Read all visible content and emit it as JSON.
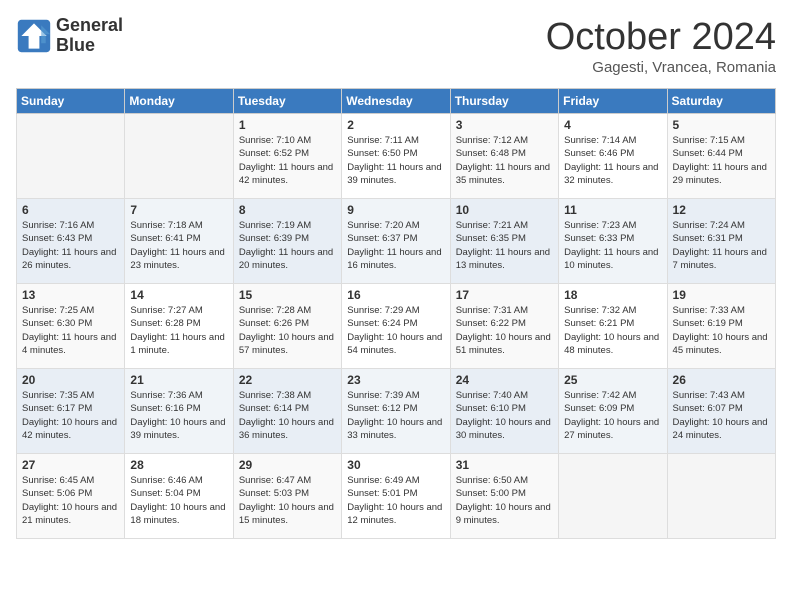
{
  "logo": {
    "line1": "General",
    "line2": "Blue"
  },
  "title": "October 2024",
  "location": "Gagesti, Vrancea, Romania",
  "days_of_week": [
    "Sunday",
    "Monday",
    "Tuesday",
    "Wednesday",
    "Thursday",
    "Friday",
    "Saturday"
  ],
  "weeks": [
    [
      {
        "day": "",
        "sunrise": "",
        "sunset": "",
        "daylight": ""
      },
      {
        "day": "",
        "sunrise": "",
        "sunset": "",
        "daylight": ""
      },
      {
        "day": "1",
        "sunrise": "Sunrise: 7:10 AM",
        "sunset": "Sunset: 6:52 PM",
        "daylight": "Daylight: 11 hours and 42 minutes."
      },
      {
        "day": "2",
        "sunrise": "Sunrise: 7:11 AM",
        "sunset": "Sunset: 6:50 PM",
        "daylight": "Daylight: 11 hours and 39 minutes."
      },
      {
        "day": "3",
        "sunrise": "Sunrise: 7:12 AM",
        "sunset": "Sunset: 6:48 PM",
        "daylight": "Daylight: 11 hours and 35 minutes."
      },
      {
        "day": "4",
        "sunrise": "Sunrise: 7:14 AM",
        "sunset": "Sunset: 6:46 PM",
        "daylight": "Daylight: 11 hours and 32 minutes."
      },
      {
        "day": "5",
        "sunrise": "Sunrise: 7:15 AM",
        "sunset": "Sunset: 6:44 PM",
        "daylight": "Daylight: 11 hours and 29 minutes."
      }
    ],
    [
      {
        "day": "6",
        "sunrise": "Sunrise: 7:16 AM",
        "sunset": "Sunset: 6:43 PM",
        "daylight": "Daylight: 11 hours and 26 minutes."
      },
      {
        "day": "7",
        "sunrise": "Sunrise: 7:18 AM",
        "sunset": "Sunset: 6:41 PM",
        "daylight": "Daylight: 11 hours and 23 minutes."
      },
      {
        "day": "8",
        "sunrise": "Sunrise: 7:19 AM",
        "sunset": "Sunset: 6:39 PM",
        "daylight": "Daylight: 11 hours and 20 minutes."
      },
      {
        "day": "9",
        "sunrise": "Sunrise: 7:20 AM",
        "sunset": "Sunset: 6:37 PM",
        "daylight": "Daylight: 11 hours and 16 minutes."
      },
      {
        "day": "10",
        "sunrise": "Sunrise: 7:21 AM",
        "sunset": "Sunset: 6:35 PM",
        "daylight": "Daylight: 11 hours and 13 minutes."
      },
      {
        "day": "11",
        "sunrise": "Sunrise: 7:23 AM",
        "sunset": "Sunset: 6:33 PM",
        "daylight": "Daylight: 11 hours and 10 minutes."
      },
      {
        "day": "12",
        "sunrise": "Sunrise: 7:24 AM",
        "sunset": "Sunset: 6:31 PM",
        "daylight": "Daylight: 11 hours and 7 minutes."
      }
    ],
    [
      {
        "day": "13",
        "sunrise": "Sunrise: 7:25 AM",
        "sunset": "Sunset: 6:30 PM",
        "daylight": "Daylight: 11 hours and 4 minutes."
      },
      {
        "day": "14",
        "sunrise": "Sunrise: 7:27 AM",
        "sunset": "Sunset: 6:28 PM",
        "daylight": "Daylight: 11 hours and 1 minute."
      },
      {
        "day": "15",
        "sunrise": "Sunrise: 7:28 AM",
        "sunset": "Sunset: 6:26 PM",
        "daylight": "Daylight: 10 hours and 57 minutes."
      },
      {
        "day": "16",
        "sunrise": "Sunrise: 7:29 AM",
        "sunset": "Sunset: 6:24 PM",
        "daylight": "Daylight: 10 hours and 54 minutes."
      },
      {
        "day": "17",
        "sunrise": "Sunrise: 7:31 AM",
        "sunset": "Sunset: 6:22 PM",
        "daylight": "Daylight: 10 hours and 51 minutes."
      },
      {
        "day": "18",
        "sunrise": "Sunrise: 7:32 AM",
        "sunset": "Sunset: 6:21 PM",
        "daylight": "Daylight: 10 hours and 48 minutes."
      },
      {
        "day": "19",
        "sunrise": "Sunrise: 7:33 AM",
        "sunset": "Sunset: 6:19 PM",
        "daylight": "Daylight: 10 hours and 45 minutes."
      }
    ],
    [
      {
        "day": "20",
        "sunrise": "Sunrise: 7:35 AM",
        "sunset": "Sunset: 6:17 PM",
        "daylight": "Daylight: 10 hours and 42 minutes."
      },
      {
        "day": "21",
        "sunrise": "Sunrise: 7:36 AM",
        "sunset": "Sunset: 6:16 PM",
        "daylight": "Daylight: 10 hours and 39 minutes."
      },
      {
        "day": "22",
        "sunrise": "Sunrise: 7:38 AM",
        "sunset": "Sunset: 6:14 PM",
        "daylight": "Daylight: 10 hours and 36 minutes."
      },
      {
        "day": "23",
        "sunrise": "Sunrise: 7:39 AM",
        "sunset": "Sunset: 6:12 PM",
        "daylight": "Daylight: 10 hours and 33 minutes."
      },
      {
        "day": "24",
        "sunrise": "Sunrise: 7:40 AM",
        "sunset": "Sunset: 6:10 PM",
        "daylight": "Daylight: 10 hours and 30 minutes."
      },
      {
        "day": "25",
        "sunrise": "Sunrise: 7:42 AM",
        "sunset": "Sunset: 6:09 PM",
        "daylight": "Daylight: 10 hours and 27 minutes."
      },
      {
        "day": "26",
        "sunrise": "Sunrise: 7:43 AM",
        "sunset": "Sunset: 6:07 PM",
        "daylight": "Daylight: 10 hours and 24 minutes."
      }
    ],
    [
      {
        "day": "27",
        "sunrise": "Sunrise: 6:45 AM",
        "sunset": "Sunset: 5:06 PM",
        "daylight": "Daylight: 10 hours and 21 minutes."
      },
      {
        "day": "28",
        "sunrise": "Sunrise: 6:46 AM",
        "sunset": "Sunset: 5:04 PM",
        "daylight": "Daylight: 10 hours and 18 minutes."
      },
      {
        "day": "29",
        "sunrise": "Sunrise: 6:47 AM",
        "sunset": "Sunset: 5:03 PM",
        "daylight": "Daylight: 10 hours and 15 minutes."
      },
      {
        "day": "30",
        "sunrise": "Sunrise: 6:49 AM",
        "sunset": "Sunset: 5:01 PM",
        "daylight": "Daylight: 10 hours and 12 minutes."
      },
      {
        "day": "31",
        "sunrise": "Sunrise: 6:50 AM",
        "sunset": "Sunset: 5:00 PM",
        "daylight": "Daylight: 10 hours and 9 minutes."
      },
      {
        "day": "",
        "sunrise": "",
        "sunset": "",
        "daylight": ""
      },
      {
        "day": "",
        "sunrise": "",
        "sunset": "",
        "daylight": ""
      }
    ]
  ]
}
